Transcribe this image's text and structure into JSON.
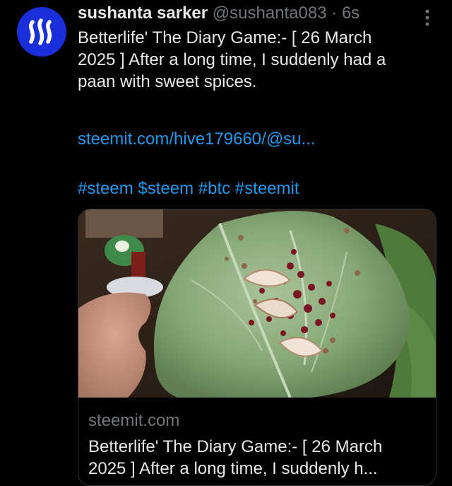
{
  "tweet": {
    "author_name": "sushanta sarker",
    "handle": "@sushanta083",
    "separator": "·",
    "time": "6s",
    "text_lines": [
      "Betterlife' The Diary Game:- [ 26 March",
      "2025 ] After a long time, I suddenly had a",
      "paan with sweet spices."
    ],
    "link_text": "steemit.com/hive179660/@su...",
    "hashtags": [
      "#steem",
      "$steem",
      "#btc",
      "#steemit"
    ]
  },
  "card": {
    "domain": "steemit.com",
    "title_lines": [
      "Betterlife' The Diary Game:- [ 26 March",
      "2025 ] After a long time, I suddenly h..."
    ]
  },
  "colors": {
    "background": "#000000",
    "link": "#1d9bf0",
    "muted": "#71767b",
    "avatar": "#1a2fdc"
  },
  "icons": {
    "avatar": "steem-logo",
    "more": "more-vertical-icon"
  }
}
